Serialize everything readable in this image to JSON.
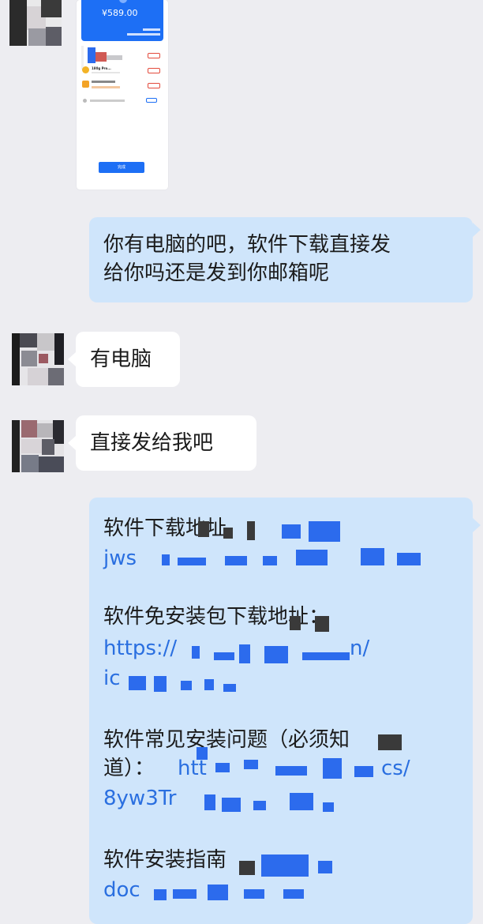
{
  "screenshot_card": {
    "amount": "¥589.00",
    "row1_title": "180g Pro...",
    "row2_title": "..."
  },
  "messages": {
    "m1_line1": "你有电脑的吧，软件下载直接发",
    "m1_line2": "给你吗还是发到你邮箱呢",
    "m2": "有电脑",
    "m3": "直接发给我吧",
    "m4_label1": "软件下载地址",
    "m4_link1": "jws",
    "m4_label2": "软件免安装包下载地址：",
    "m4_link2a": "https://",
    "m4_link2b": "n/",
    "m4_link2c": "ic",
    "m4_label3_line1": "软件常见安装问题（必须知",
    "m4_label3_line2a": "道）：",
    "m4_link3a": "htt",
    "m4_link3b": "cs/",
    "m4_link3c": "8yw3Tr",
    "m4_label4": "软件安装指南",
    "m4_link4": "doc"
  },
  "colors": {
    "background": "#ededf1",
    "outgoing_bubble": "#cfe5fb",
    "incoming_bubble": "#ffffff",
    "link": "#2a6fe0",
    "redaction": "#2c6bed"
  }
}
